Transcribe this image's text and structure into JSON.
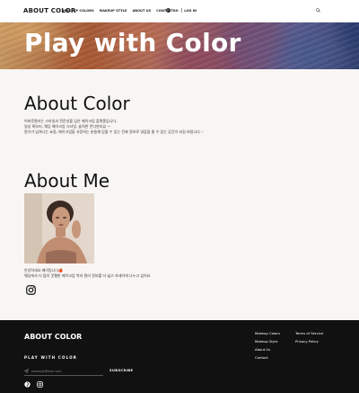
{
  "header": {
    "logo": "ABOUT COLOR",
    "nav": [
      "MAKEUP COLORS",
      "MAKEUP STYLE",
      "ABOUT US",
      "CONTACT"
    ],
    "lang": "KO",
    "login": "LOG IN"
  },
  "hero": {
    "title": "Play with Color"
  },
  "about_color": {
    "heading": "About Color",
    "lines": [
      "어바웃컬러는 스타일과 전문성을 담은 메이크업 플랫폼입니다.",
      "일상 룩부터, 웨딩 메이크업 스타일, 솔직한 컨디한리뷰 —",
      "뭔가가 넘쳐나는 요즘, 메이크업을 사랑하는 분들께 믿을 수 있는 진짜 정보로 영감을 줄 수 있는 공간이 되길 바랍니다 :-"
    ]
  },
  "about_me": {
    "heading": "About Me",
    "lines": [
      "안녕하세요 메이킹니다🍎",
      "웨딩에서 더 많이 웃쨍한 메이크업 북과 컬러 정보를 더 넓고 자세하게 나누고 싶어요"
    ]
  },
  "footer": {
    "logo": "ABOUT COLOR",
    "tagline": "PLAY WITH COLOR",
    "email_placeholder": "example@mail.com",
    "subscribe": "SUBSCRIBE",
    "links_col1": [
      "Makeup Colors",
      "Makeup Style",
      "About Us",
      "Contact"
    ],
    "links_col2": [
      "Terms of Service",
      "Privacy Policy"
    ]
  },
  "icons": [
    "search-icon",
    "globe-icon",
    "instagram-icon",
    "pinterest-icon",
    "send-icon"
  ]
}
